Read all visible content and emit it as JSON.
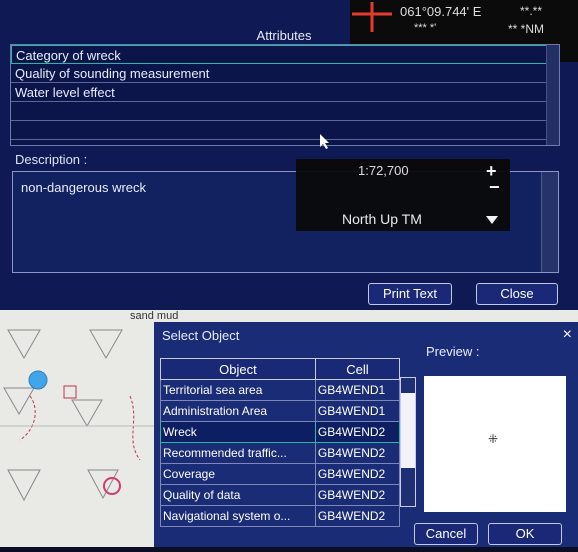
{
  "coord_readout": {
    "longitude": "061°09.744' E",
    "latitude_masked": "*** *'",
    "right_top": "**.**",
    "right_unit": "** *NM"
  },
  "attributes": {
    "header": "Attributes",
    "rows": [
      {
        "label": "Category of wreck"
      },
      {
        "label": "Quality of sounding measurement"
      },
      {
        "label": "Water level effect"
      },
      {
        "label": ""
      },
      {
        "label": ""
      }
    ]
  },
  "description": {
    "label": "Description :",
    "text": "non-dangerous wreck"
  },
  "chart_overlay": {
    "scale": "1:72,700",
    "plus": "+",
    "minus": "−",
    "orientation": "North  Up TM"
  },
  "top_buttons": {
    "print": "Print Text",
    "close": "Close"
  },
  "map_label": "sand mud",
  "select_dialog": {
    "title": "Select Object",
    "close_glyph": "×",
    "columns": [
      "Object",
      "Cell"
    ],
    "rows": [
      {
        "object": "Territorial sea area",
        "cell": "GB4WEND1"
      },
      {
        "object": "Administration Area",
        "cell": "GB4WEND1"
      },
      {
        "object": "Wreck",
        "cell": "GB4WEND2"
      },
      {
        "object": "Recommended traffic...",
        "cell": "GB4WEND2"
      },
      {
        "object": "Coverage",
        "cell": "GB4WEND2"
      },
      {
        "object": "Quality of data",
        "cell": "GB4WEND2"
      },
      {
        "object": "Navigational system o...",
        "cell": "GB4WEND2"
      }
    ],
    "selected_row": 2,
    "preview_label": "Preview :",
    "cancel": "Cancel",
    "ok": "OK"
  },
  "colors": {
    "panel_bg": "#0f1a55",
    "selection": "#29b6a8",
    "crosshair": "#e53b2f"
  }
}
